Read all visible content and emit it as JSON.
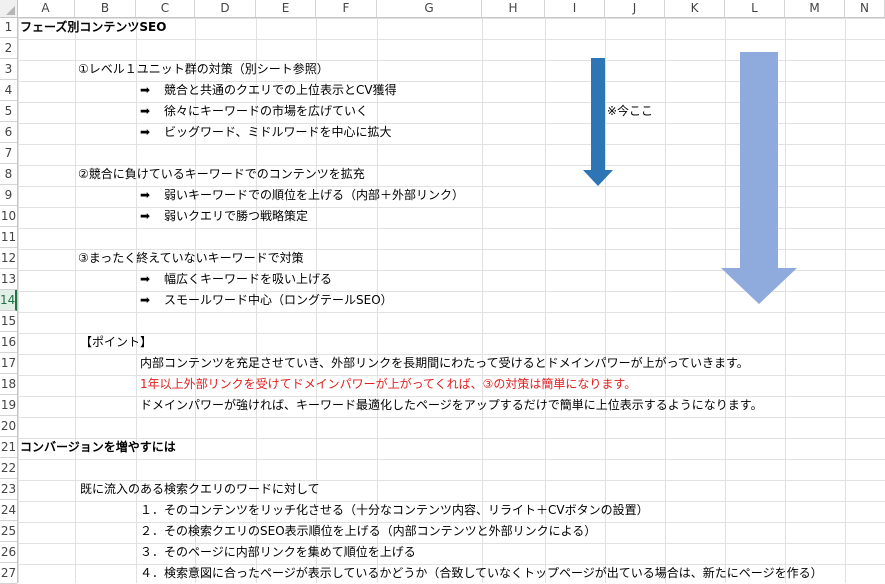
{
  "columns": [
    "A",
    "B",
    "C",
    "D",
    "E",
    "F",
    "G",
    "H",
    "I",
    "J",
    "K",
    "L",
    "M",
    "N"
  ],
  "rows": [
    "1",
    "2",
    "3",
    "4",
    "5",
    "6",
    "7",
    "8",
    "9",
    "10",
    "11",
    "12",
    "13",
    "14",
    "15",
    "16",
    "17",
    "18",
    "19",
    "20",
    "21",
    "22",
    "23",
    "24",
    "25",
    "26",
    "27"
  ],
  "selected_row": "14",
  "colors": {
    "dark_arrow": "#2e75b6",
    "light_arrow": "#8faadc",
    "red_text": "#e02020",
    "selection": "#217346"
  },
  "cells": {
    "r1": "フェーズ別コンテンツSEO",
    "r3": "①レベル１ユニット群の対策（別シート参照）",
    "r4": "競合と共通のクエリでの上位表示とCV獲得",
    "r5": "徐々にキーワードの市場を広げていく",
    "r5_note": "※今ここ",
    "r6": "ビッグワード、ミドルワードを中心に拡大",
    "r8": "②競合に負けているキーワードでのコンテンツを拡充",
    "r9": "弱いキーワードでの順位を上げる（内部＋外部リンク）",
    "r10": "弱いクエリで勝つ戦略策定",
    "r12": "③まったく終えていないキーワードで対策",
    "r13": "幅広くキーワードを吸い上げる",
    "r14": "スモールワード中心（ロングテールSEO）",
    "r16": "【ポイント】",
    "r17": "内部コンテンツを充足させていき、外部リンクを長期間にわたって受けるとドメインパワーが上がっていきます。",
    "r18": "1年以上外部リンクを受けてドメインパワーが上がってくれば、③の対策は簡単になります。",
    "r19": "ドメインパワーが強ければ、キーワード最適化したページをアップするだけで簡単に上位表示するようになります。",
    "r21": "コンバージョンを増やすには",
    "r23": "既に流入のある検索クエリのワードに対して",
    "r24": "１．そのコンテンツをリッチ化させる（十分なコンテンツ内容、リライト＋CVボタンの設置）",
    "r25": "２．その検索クエリのSEO表示順位を上げる（内部コンテンツと外部リンクによる）",
    "r26": "３．そのページに内部リンクを集めて順位を上げる",
    "r27": "４．検索意図に合ったページが表示しているかどうか（合致していなくトップページが出ている場合は、新たにページを作る）"
  },
  "bullet": "➡"
}
